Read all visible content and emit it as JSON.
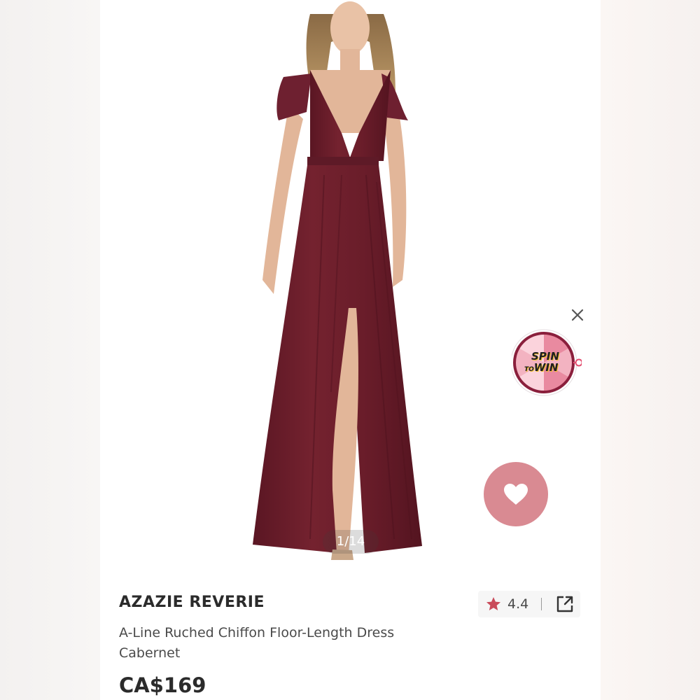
{
  "gallery": {
    "counter": "1/14",
    "image_alt": "Model wearing long cabernet chiffon dress with front slit"
  },
  "promo": {
    "spin_line1": "SPIN",
    "spin_line2_prefix": "TO",
    "spin_line2_main": "WIN"
  },
  "product": {
    "brand": "AZAZIE REVERIE",
    "name": "A-Line Ruched Chiffon Floor-Length Dress",
    "color": "Cabernet",
    "price": "CA$169",
    "rating": "4.4"
  },
  "colors": {
    "dress": "#6b1f2c",
    "favorite_button": "#d98a92",
    "star": "#c94b5a"
  },
  "icons": {
    "close": "close-icon",
    "heart": "heart-icon",
    "star": "star-icon",
    "share": "external-link-icon"
  }
}
